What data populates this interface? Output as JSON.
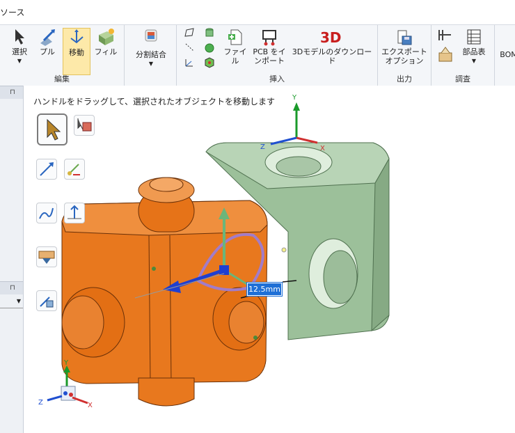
{
  "titlebar": {
    "text": "ソース"
  },
  "ribbon": {
    "groups": {
      "edit": "編集",
      "insert": "挿入",
      "output": "出力",
      "inspect": "調査"
    },
    "buttons": {
      "select": "選択",
      "pull": "プル",
      "move": "移動",
      "fill": "フィル",
      "split_combine": "分割結合",
      "file": "ファイル",
      "pcb_line1": "PCB をイ",
      "pcb_line2": "ンポート",
      "model_download": "3Dモデルのダウンロード",
      "export_line1": "エクスポート",
      "export_line2": "オプション",
      "bom_table": "部品表",
      "bom": "BOM"
    }
  },
  "viewport": {
    "hint": "ハンドルをドラッグして、選択されたオブジェクトを移動します",
    "dimension": "12.5mm",
    "axes": {
      "x": "X",
      "y": "Y",
      "z": "Z"
    }
  },
  "colors": {
    "orange_cube": "#e8781e",
    "green_cube": "#9cc09a",
    "active_button": "#fde9a9",
    "dimension_bg": "#1e6fd6"
  }
}
